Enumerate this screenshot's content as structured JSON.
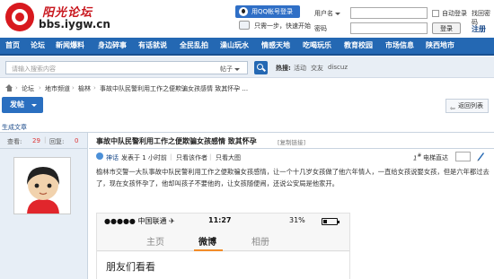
{
  "site": {
    "name": "阳光论坛",
    "url": "bbs.iygw.cn"
  },
  "login": {
    "qq_login_label": "用QQ帐号登录",
    "quick_login_label": "只需一步，快速开始",
    "username_label": "用户名",
    "password_label": "密码",
    "auto_login_label": "自动登录",
    "login_button": "登录",
    "forgot_label": "找回密码",
    "register_label": "注册"
  },
  "nav": {
    "items": [
      "首页",
      "论坛",
      "新闻爆料",
      "身边碎事",
      "有话就说",
      "全民乱拍",
      "澡山玩水",
      "情感天地",
      "吃喝玩乐",
      "教育校园",
      "市场信息",
      "陕西地市"
    ]
  },
  "search": {
    "placeholder": "请输入搜索内容",
    "type_label": "帖子",
    "hot_label": "热搜:",
    "hot_items": [
      "活动",
      "交友",
      "discuz"
    ]
  },
  "breadcrumb": {
    "items": [
      "论坛",
      "地市频道",
      "榆林",
      "事故中队民警利用工作之便欺骗女孩感情 致其怀孕 ..."
    ]
  },
  "actions": {
    "post_label": "发帖",
    "back_label": "返回列表"
  },
  "generate_link": "生成文章",
  "thread": {
    "views_label": "查看:",
    "views": "29",
    "replies_label": "回复:",
    "replies": "0",
    "title": "事故中队民警利用工作之便欺骗女孩感情 致其怀孕",
    "copy_link_label": "[复制链接]",
    "author": "神话",
    "posted_time": "发表于 1 小时前",
    "only_author": "只看该作者",
    "large_image": "只看大图",
    "floor_symbol": "1",
    "floor_prefix": "#",
    "jump_label": "电梯直达",
    "content": "榆林市交警一大队事故中队民警利用工作之便欺骗女孩感情，让一个十几岁女孩做了他六年情人，一直给女孩说娶女孩，但是六年都过去了，现在女孩怀孕了，他却叫孩子不要他的，让女孩随便闹，还说公安局是他家开。"
  },
  "phone": {
    "carrier": "●●●●● 中国联通 ✈",
    "time": "11:27",
    "battery": "31%",
    "tabs": [
      "主页",
      "微博",
      "相册"
    ],
    "active_tab": "微博",
    "heading": "朋友们看看"
  },
  "colors": {
    "brand_red": "#d8191e",
    "nav_blue": "#2468b3",
    "side_bg": "#e7eef6",
    "accent_orange": "#f28b28"
  }
}
